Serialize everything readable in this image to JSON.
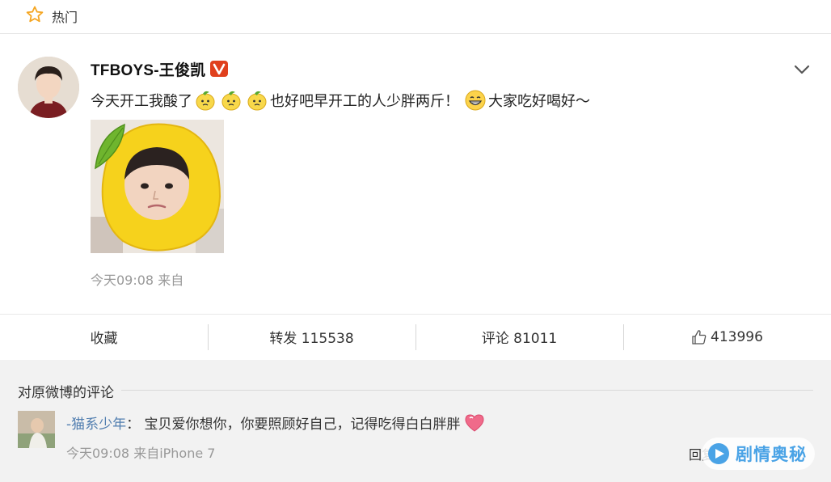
{
  "hot": {
    "label": "热门"
  },
  "post": {
    "username": "TFBOYS-王俊凯",
    "text_part1": "今天开工我酸了",
    "text_part2": "也好吧早开工的人少胖两斤！",
    "text_part3": "大家吃好喝好～",
    "meta": "今天09:08 来自"
  },
  "actions": {
    "collect": "收藏",
    "repost": "转发 115538",
    "comment": "评论 81011",
    "like": "413996"
  },
  "comments": {
    "header": "对原微博的评论",
    "items": [
      {
        "name": "-猫系少年",
        "text": "：  宝贝爱你想你，你要照顾好自己，记得吃得白白胖胖",
        "meta": "今天09:08 来自iPhone 7",
        "reply": "回复"
      }
    ]
  },
  "watermark": {
    "text": "剧情奥秘"
  },
  "colors": {
    "link_blue": "#507daf",
    "vip_red": "#e0401d",
    "star_orange": "#f5a623",
    "watermark_blue": "#4aa3e6"
  }
}
